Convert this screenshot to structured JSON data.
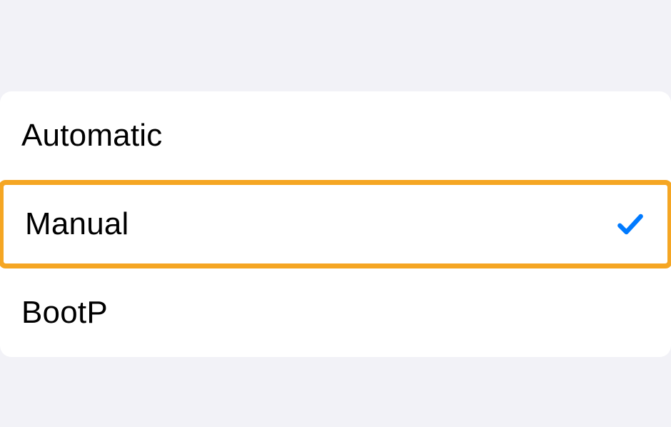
{
  "options": {
    "automatic": {
      "label": "Automatic",
      "selected": false,
      "highlighted": false
    },
    "manual": {
      "label": "Manual",
      "selected": true,
      "highlighted": true
    },
    "bootp": {
      "label": "BootP",
      "selected": false,
      "highlighted": false
    }
  },
  "colors": {
    "checkmark": "#007aff",
    "highlight": "#f5a623",
    "background": "#f2f2f7"
  }
}
